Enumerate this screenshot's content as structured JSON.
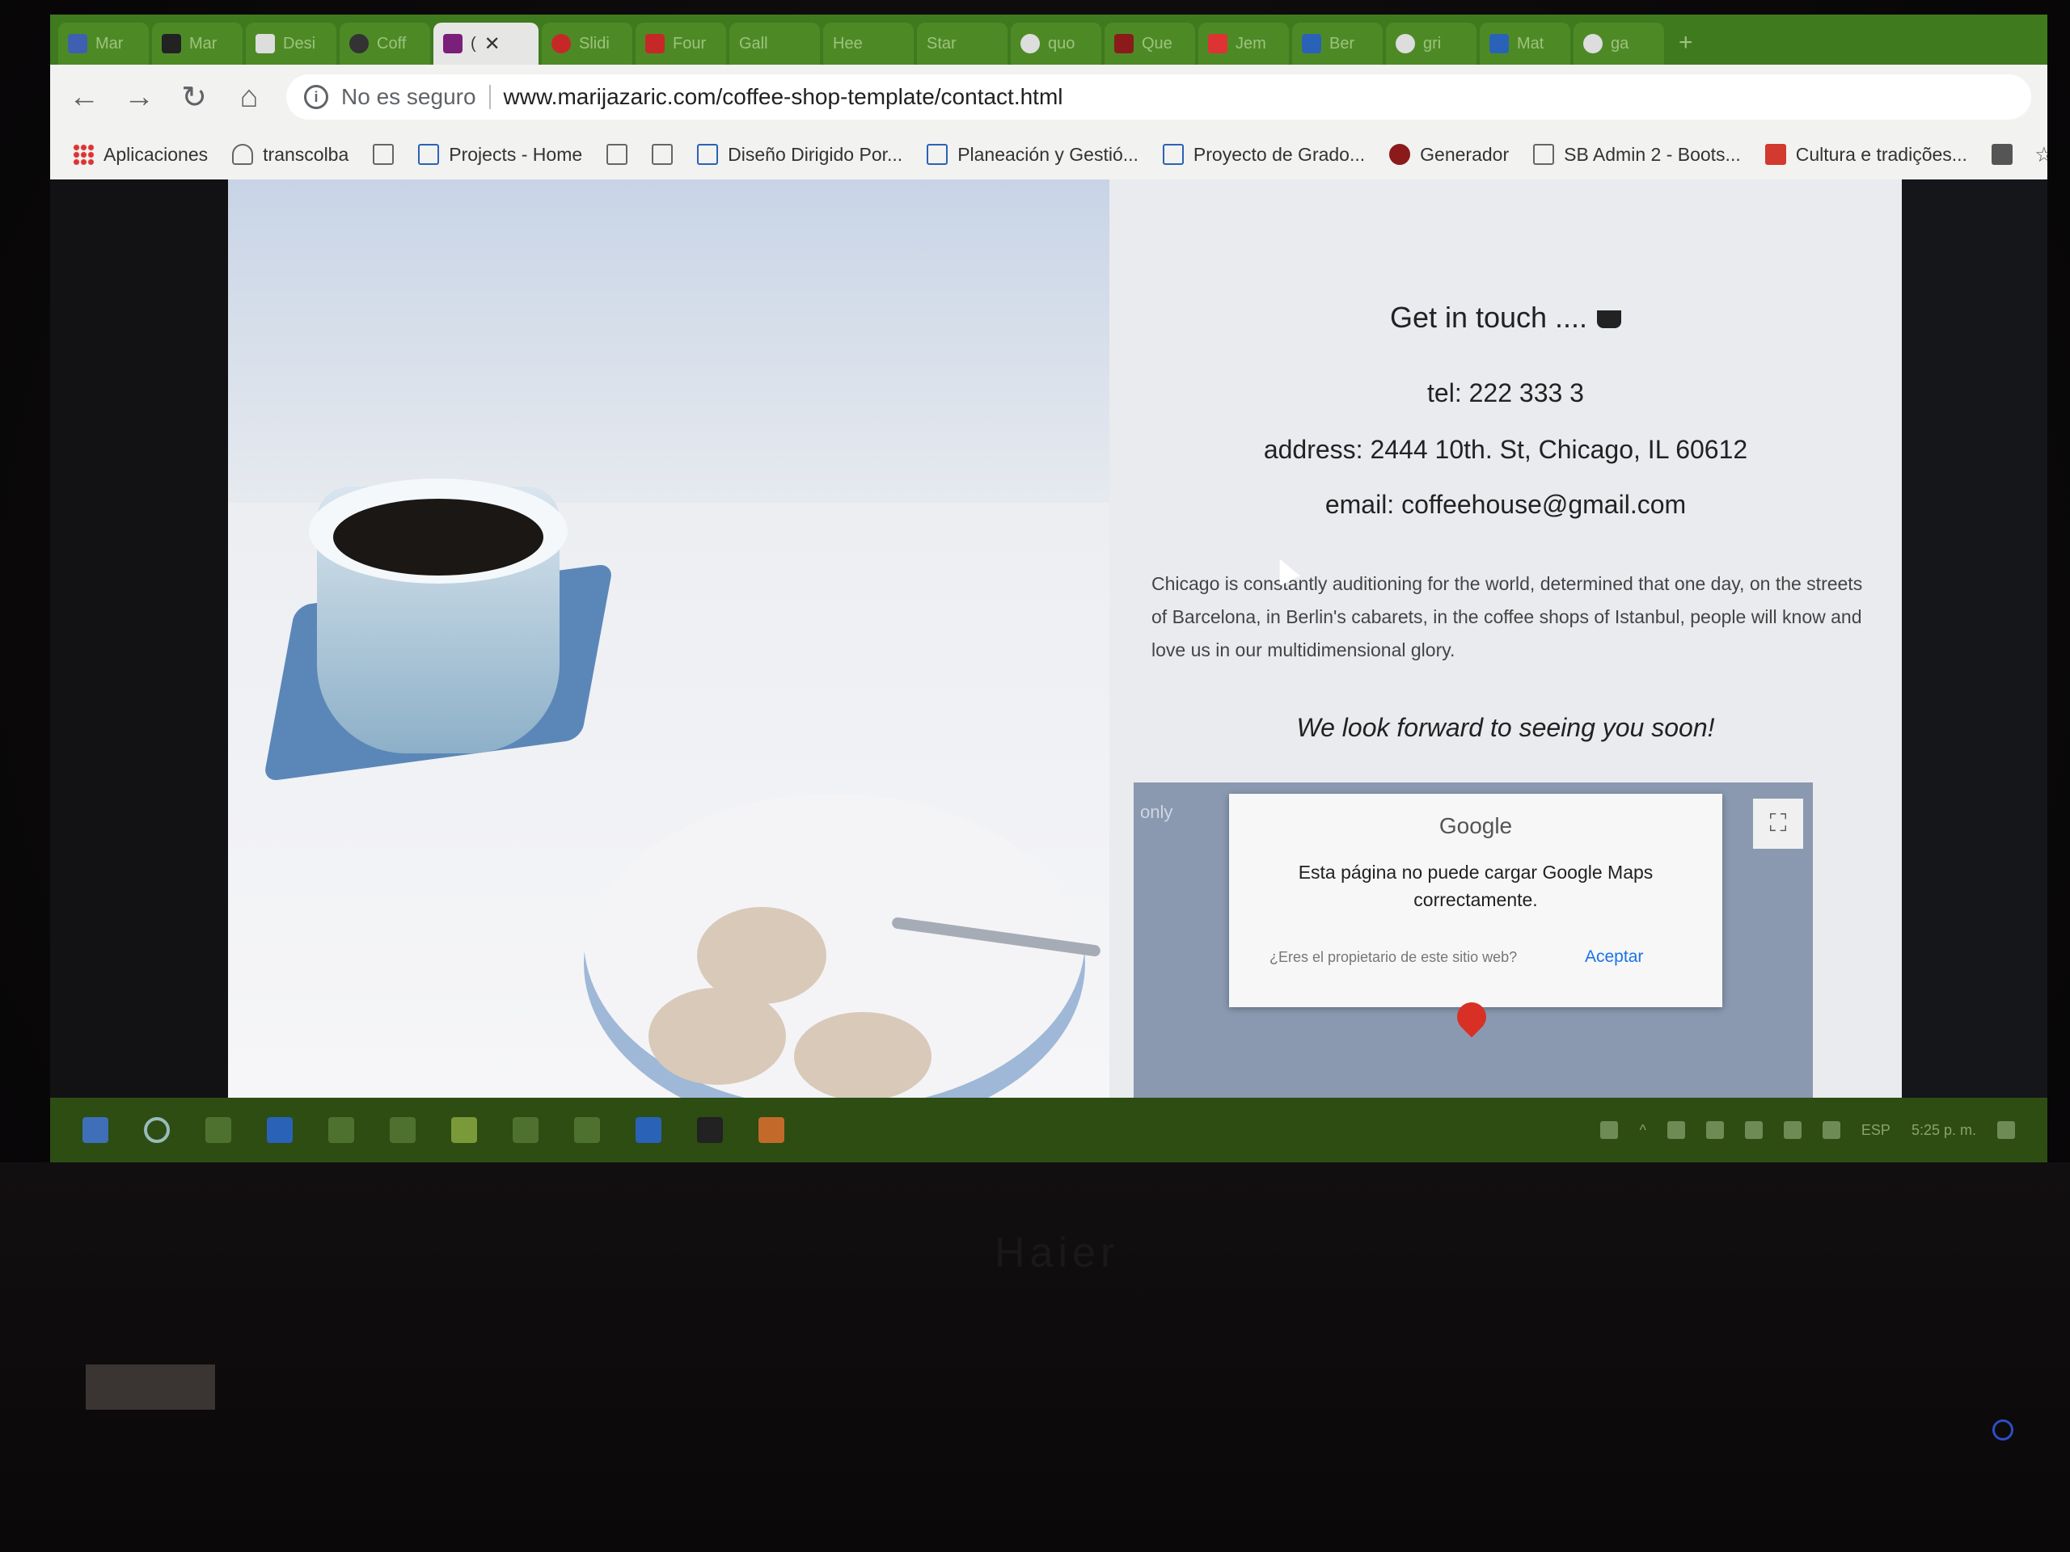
{
  "browser": {
    "tabs": [
      {
        "label": "Mar",
        "color": "#3f5fb0"
      },
      {
        "label": "Mar",
        "color": "#222222"
      },
      {
        "label": "Desi",
        "color": "#dddddd"
      },
      {
        "label": "Coff",
        "color": "#333333"
      },
      {
        "label": "(",
        "color": "#7a1f7a",
        "active": true
      },
      {
        "label": "Slidi",
        "color": "#c62828"
      },
      {
        "label": "Four",
        "color": "#c62828"
      },
      {
        "label": "Gall",
        "color": "#4d8a26"
      },
      {
        "label": "Hee",
        "color": "#4d8a26"
      },
      {
        "label": "Star",
        "color": "#4d8a26"
      },
      {
        "label": "quo",
        "color": "#dddddd"
      },
      {
        "label": "Que",
        "color": "#8b1b1b"
      },
      {
        "label": "Jem",
        "color": "#d33"
      },
      {
        "label": "Ber",
        "color": "#2a62b8"
      },
      {
        "label": "gri",
        "color": "#dddddd"
      },
      {
        "label": "Mat",
        "color": "#2a62b8"
      },
      {
        "label": "ga",
        "color": "#dddddd"
      }
    ],
    "new_tab_symbol": "+",
    "toolbar": {
      "back_symbol": "←",
      "forward_symbol": "→",
      "reload_symbol": "↻",
      "home_symbol": "⌂",
      "security_label": "No es seguro",
      "url": "www.marijazaric.com/coffee-shop-template/contact.html"
    },
    "bookmarks": [
      {
        "label": "Aplicaciones",
        "icon": "grid"
      },
      {
        "label": "transcolba",
        "icon": "cloud"
      },
      {
        "label": "",
        "icon": "page"
      },
      {
        "label": "Projects - Home",
        "icon": "blue"
      },
      {
        "label": "",
        "icon": "page"
      },
      {
        "label": "",
        "icon": "page"
      },
      {
        "label": "Diseño Dirigido Por...",
        "icon": "blue"
      },
      {
        "label": "Planeación y Gestió...",
        "icon": "blue"
      },
      {
        "label": "Proyecto de Grado...",
        "icon": "blue"
      },
      {
        "label": "Generador",
        "icon": "red"
      },
      {
        "label": "SB Admin 2 - Boots...",
        "icon": "page"
      },
      {
        "label": "Cultura e tradições...",
        "icon": "redflag"
      }
    ],
    "more_bookmarks_symbol": "»"
  },
  "page": {
    "heading": "Get in touch ....",
    "tel": "tel: 222 333 3",
    "address": "address: 2444 10th. St, Chicago, IL 60612",
    "email": "email: coffeehouse@gmail.com",
    "blurb": "Chicago is constantly auditioning for the world, determined that one day, on the streets of Barcelona, in Berlin's cabarets, in the coffee shops of Istanbul, people will know and love us in our multidimensional glory.",
    "closing": "We look forward to seeing you soon!",
    "map": {
      "corner_label": "only",
      "provider": "Google",
      "error_message": "Esta página no puede cargar Google Maps correctamente.",
      "owner_question": "¿Eres el propietario de este sitio web?",
      "accept_label": "Aceptar",
      "fullscreen_symbol": "⛶"
    }
  },
  "taskbar": {
    "language": "ESP",
    "clock": "5:25 p. m."
  },
  "laptop": {
    "brand": "Haier"
  }
}
